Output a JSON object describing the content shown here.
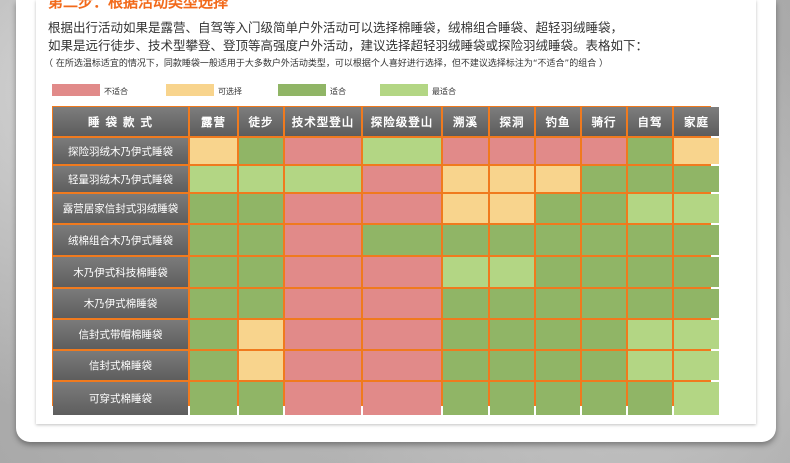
{
  "heading": "第二步：根据活动类型选择",
  "intro": {
    "line1": "根据出行活动如果是露营、自驾等入门级简单户外活动可以选择棉睡袋，绒棉组合睡袋、超轻羽绒睡袋，",
    "line2": "如果是远行徒步、技术型攀登、登顶等高强度户外活动，建议选择超轻羽绒睡袋或探险羽绒睡袋。表格如下："
  },
  "note": "（ 在所选温标适宜的情况下，同款睡袋一般适用于大多数户外活动类型，可以根据个人喜好进行选择，但不建议选择标注为“不适合”的组合 ）",
  "legend": [
    {
      "label": "不适合",
      "color": "#e18a89"
    },
    {
      "label": "可选择",
      "color": "#f8d48d"
    },
    {
      "label": "适合",
      "color": "#90b566"
    },
    {
      "label": "最适合",
      "color": "#b3d684"
    }
  ],
  "table": {
    "corner": "睡 袋 款 式",
    "columns": [
      "露营",
      "徒步",
      "技术型登山",
      "探险级登山",
      "溯溪",
      "探洞",
      "钓鱼",
      "骑行",
      "自驾",
      "家庭"
    ],
    "rows": [
      {
        "name": "探险羽绒木乃伊式睡袋",
        "values": [
          "ok",
          "good",
          "bad",
          "best",
          "bad",
          "bad",
          "bad",
          "bad",
          "good",
          "ok"
        ]
      },
      {
        "name": "轻量羽绒木乃伊式睡袋",
        "values": [
          "best",
          "best",
          "best",
          "bad",
          "ok",
          "ok",
          "ok",
          "good",
          "good",
          "good"
        ]
      },
      {
        "name": "露营居家信封式羽绒睡袋",
        "values": [
          "good",
          "good",
          "bad",
          "bad",
          "ok",
          "ok",
          "good",
          "good",
          "best",
          "best"
        ]
      },
      {
        "name": "绒棉组合木乃伊式睡袋",
        "values": [
          "good",
          "good",
          "bad",
          "good",
          "good",
          "good",
          "good",
          "good",
          "good",
          "good"
        ]
      },
      {
        "name": "木乃伊式科技棉睡袋",
        "values": [
          "good",
          "good",
          "bad",
          "bad",
          "best",
          "best",
          "good",
          "good",
          "good",
          "good"
        ]
      },
      {
        "name": "木乃伊式棉睡袋",
        "values": [
          "good",
          "good",
          "bad",
          "bad",
          "good",
          "good",
          "good",
          "good",
          "good",
          "good"
        ]
      },
      {
        "name": "信封式带帽棉睡袋",
        "values": [
          "good",
          "ok",
          "bad",
          "bad",
          "good",
          "good",
          "good",
          "good",
          "best",
          "best"
        ]
      },
      {
        "name": "信封式棉睡袋",
        "values": [
          "good",
          "ok",
          "bad",
          "bad",
          "good",
          "good",
          "good",
          "good",
          "best",
          "best"
        ]
      },
      {
        "name": "可穿式棉睡袋",
        "values": [
          "good",
          "good",
          "bad",
          "bad",
          "good",
          "good",
          "good",
          "good",
          "good",
          "best"
        ]
      }
    ]
  }
}
